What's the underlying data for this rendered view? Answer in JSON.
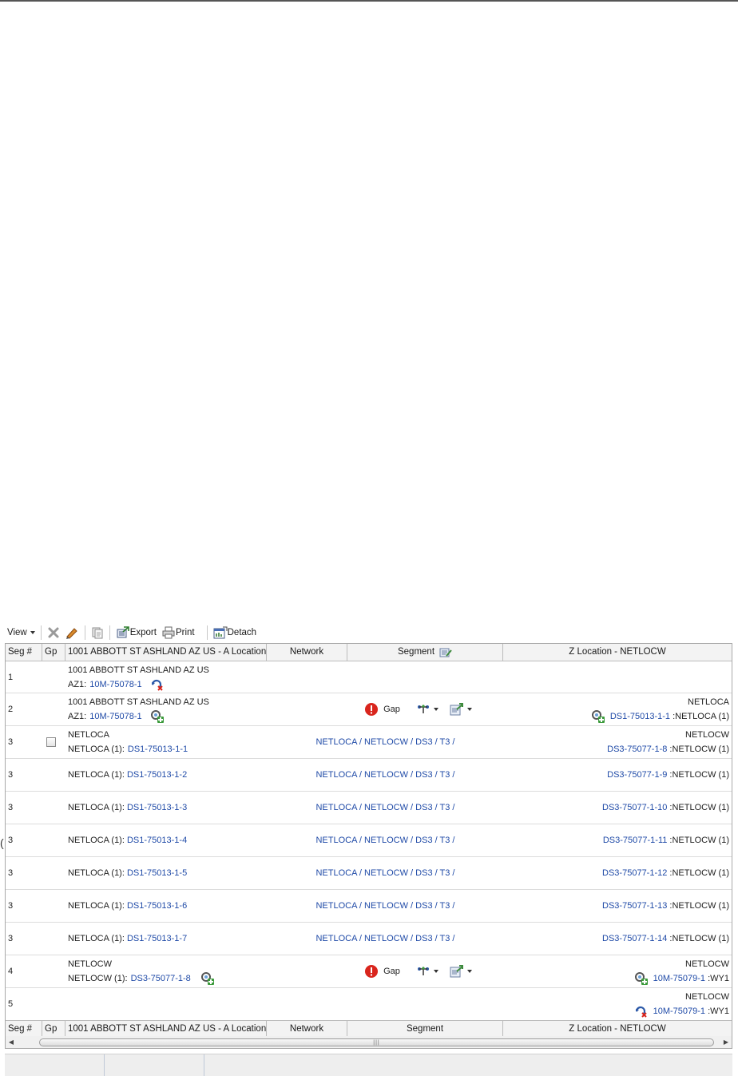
{
  "toolbar": {
    "view_label": "View",
    "export_label": "Export",
    "print_label": "Print",
    "detach_label": "Detach"
  },
  "columns": {
    "seg": "Seg #",
    "gp": "Gp",
    "a_location": "1001 ABBOTT ST ASHLAND AZ US - A Location",
    "network": "Network",
    "segment": "Segment",
    "z_location": "Z Location - NETLOCW"
  },
  "rows": [
    {
      "seg": "1",
      "a_line1": "1001 ABBOTT ST ASHLAND AZ US",
      "a_prefix": "AZ1: ",
      "a_link": "10M-75078-1",
      "a_icon": "disconnect-icon"
    },
    {
      "seg": "2",
      "a_line1": "1001 ABBOTT ST ASHLAND AZ US",
      "a_prefix": "AZ1: ",
      "a_link": "10M-75078-1",
      "a_icon": "add-connection-icon",
      "gap_label": "Gap",
      "z_line1": "NETLOCA",
      "z_link": "DS1-75013-1-1",
      "z_suffix": " :NETLOCA (1)",
      "z_icon": "add-connection-icon"
    },
    {
      "seg": "3",
      "checkbox": true,
      "a_line1": "NETLOCA",
      "a_prefix": "NETLOCA (1): ",
      "a_link": "DS1-75013-1-1",
      "segment_path": "NETLOCA / NETLOCW / DS3 / T3 /",
      "z_line1": "NETLOCW",
      "z_link": "DS3-75077-1-8",
      "z_suffix": " :NETLOCW (1)"
    },
    {
      "seg": "3",
      "a_prefix": "NETLOCA (1): ",
      "a_link": "DS1-75013-1-2",
      "segment_path": "NETLOCA / NETLOCW / DS3 / T3 /",
      "z_link": "DS3-75077-1-9",
      "z_suffix": " :NETLOCW (1)"
    },
    {
      "seg": "3",
      "a_prefix": "NETLOCA (1): ",
      "a_link": "DS1-75013-1-3",
      "segment_path": "NETLOCA / NETLOCW / DS3 / T3 /",
      "z_link": "DS3-75077-1-10",
      "z_suffix": " :NETLOCW (1)"
    },
    {
      "seg": "3",
      "a_prefix": "NETLOCA (1): ",
      "a_link": "DS1-75013-1-4",
      "segment_path": "NETLOCA / NETLOCW / DS3 / T3 /",
      "z_link": "DS3-75077-1-11",
      "z_suffix": " :NETLOCW (1)"
    },
    {
      "seg": "3",
      "a_prefix": "NETLOCA (1): ",
      "a_link": "DS1-75013-1-5",
      "segment_path": "NETLOCA / NETLOCW / DS3 / T3 /",
      "z_link": "DS3-75077-1-12",
      "z_suffix": " :NETLOCW (1)"
    },
    {
      "seg": "3",
      "a_prefix": "NETLOCA (1): ",
      "a_link": "DS1-75013-1-6",
      "segment_path": "NETLOCA / NETLOCW / DS3 / T3 /",
      "z_link": "DS3-75077-1-13",
      "z_suffix": " :NETLOCW (1)"
    },
    {
      "seg": "3",
      "a_prefix": "NETLOCA (1): ",
      "a_link": "DS1-75013-1-7",
      "segment_path": "NETLOCA / NETLOCW / DS3 / T3 /",
      "z_link": "DS3-75077-1-14",
      "z_suffix": " :NETLOCW (1)"
    },
    {
      "seg": "4",
      "a_line1": "NETLOCW",
      "a_prefix": "NETLOCW (1): ",
      "a_link": "DS3-75077-1-8",
      "a_icon": "add-connection-icon",
      "gap_label": "Gap",
      "z_line1": "NETLOCW",
      "z_link": "10M-75079-1",
      "z_suffix": " :WY1",
      "z_icon": "add-connection-icon"
    },
    {
      "seg": "5",
      "z_line1": "NETLOCW",
      "z_link": "10M-75079-1",
      "z_suffix": " :WY1",
      "z_icon": "disconnect-icon"
    }
  ],
  "colors": {
    "link": "#1f4aa7",
    "error": "#d9251d",
    "header_bg": "#f3f3f3"
  }
}
